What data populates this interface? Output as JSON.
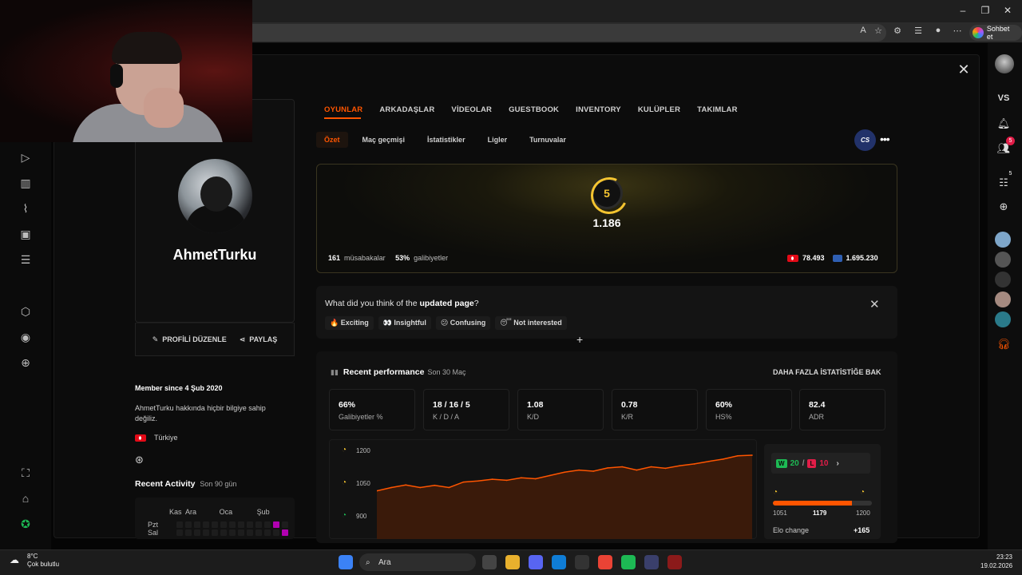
{
  "browser": {
    "chat_button": "Sohbet et"
  },
  "tabs": [
    "OYUNLAR",
    "ARKADAŞLAR",
    "VİDEOLAR",
    "GUESTBOOK",
    "INVENTORY",
    "KULÜPLER",
    "TAKIMLAR"
  ],
  "subtabs": [
    "Özet",
    "Maç geçmişi",
    "İstatistikler",
    "Ligler",
    "Turnuvalar"
  ],
  "game_badge": "CS",
  "profile": {
    "username": "AhmetTurku",
    "edit_label": "PROFİLİ DÜZENLE",
    "share_label": "PAYLAŞ",
    "member_since": "Member since 4 Şub 2020",
    "about": "AhmetTurku hakkında hiçbir bilgiye sahip değiliz.",
    "country": "Türkiye"
  },
  "recent_activity": {
    "title": "Recent Activity",
    "period": "Son 90 gün",
    "months": [
      "Kas",
      "Ara",
      "Oca",
      "Şub"
    ],
    "days": [
      "Pzt",
      "Sal"
    ]
  },
  "hero": {
    "level": "5",
    "elo": "1.186",
    "matches": "161",
    "matches_label": "müsabakalar",
    "winrate": "53%",
    "winrate_label": "galibiyetler",
    "country_rank": "78.493",
    "region_rank": "1.695.230"
  },
  "feedback": {
    "question_prefix": "What did you think of the ",
    "question_bold": "updated page",
    "question_suffix": "?",
    "options": [
      "🔥 Exciting",
      "👀 Insightful",
      "😕 Confusing",
      "😴 Not interested"
    ]
  },
  "performance": {
    "title": "Recent performance",
    "period": "Son 30 Maç",
    "link": "DAHA FAZLA İSTATİSTİĞE BAK",
    "stats": [
      {
        "value": "66%",
        "label": "Galibiyetler %"
      },
      {
        "value": "18 / 16 / 5",
        "label": "K / D / A"
      },
      {
        "value": "1.08",
        "label": "K/D"
      },
      {
        "value": "0.78",
        "label": "K/R"
      },
      {
        "value": "60%",
        "label": "HS%"
      },
      {
        "value": "82.4",
        "label": "ADR"
      }
    ],
    "wins": "20",
    "losses": "10",
    "win_tag": "W",
    "loss_tag": "L",
    "elo_min": "1051",
    "elo_current": "1179",
    "elo_max": "1200",
    "elo_change_label": "Elo change",
    "elo_change": "+165"
  },
  "chart_data": {
    "type": "line",
    "title": "",
    "xlabel": "",
    "ylabel": "",
    "y_ticks": [
      "1200",
      "1050",
      "900"
    ],
    "ylim": [
      900,
      1200
    ],
    "series": [
      {
        "values": [
          1015,
          1030,
          1042,
          1030,
          1040,
          1030,
          1055,
          1060,
          1068,
          1063,
          1075,
          1070,
          1085,
          1100,
          1110,
          1105,
          1120,
          1125,
          1110,
          1125,
          1118,
          1130,
          1138,
          1150,
          1160,
          1175,
          1178
        ]
      }
    ],
    "color": "#ff5500"
  },
  "right_sidebar": {
    "vs_label": "VS",
    "friends_badge": "5",
    "party_badge": "5"
  },
  "taskbar": {
    "weather_temp": "8°C",
    "weather_desc": "Çok bulutlu",
    "search": "Ara",
    "time": "23:23",
    "date": "19.02.2026"
  }
}
